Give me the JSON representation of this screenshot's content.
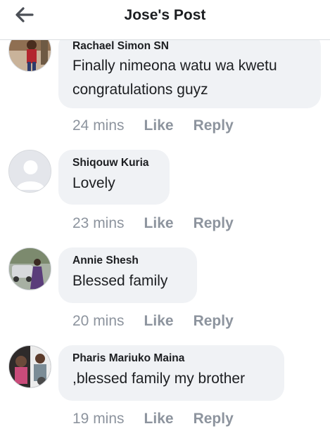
{
  "header": {
    "title": "Jose's Post",
    "back_icon": "arrow-left-icon"
  },
  "comments": [
    {
      "author": "Rachael Simon SN",
      "lines": [
        "Finally nimeona watu wa kwetu",
        "congratulations guyz"
      ],
      "time": "24 mins",
      "like": "Like",
      "reply": "Reply"
    },
    {
      "author": "Shiqouw Kuria",
      "lines": [
        "Lovely"
      ],
      "time": "23 mins",
      "like": "Like",
      "reply": "Reply"
    },
    {
      "author": "Annie Shesh",
      "lines": [
        "Blessed family"
      ],
      "time": "20 mins",
      "like": "Like",
      "reply": "Reply"
    },
    {
      "author": "Pharis Mariuko Maina",
      "lines": [
        ",blessed family my brother"
      ],
      "time": "19 mins",
      "like": "Like",
      "reply": "Reply"
    }
  ],
  "colors": {
    "bubble": "#f0f2f5",
    "meta": "#8d949e",
    "text": "#1c1e21"
  }
}
